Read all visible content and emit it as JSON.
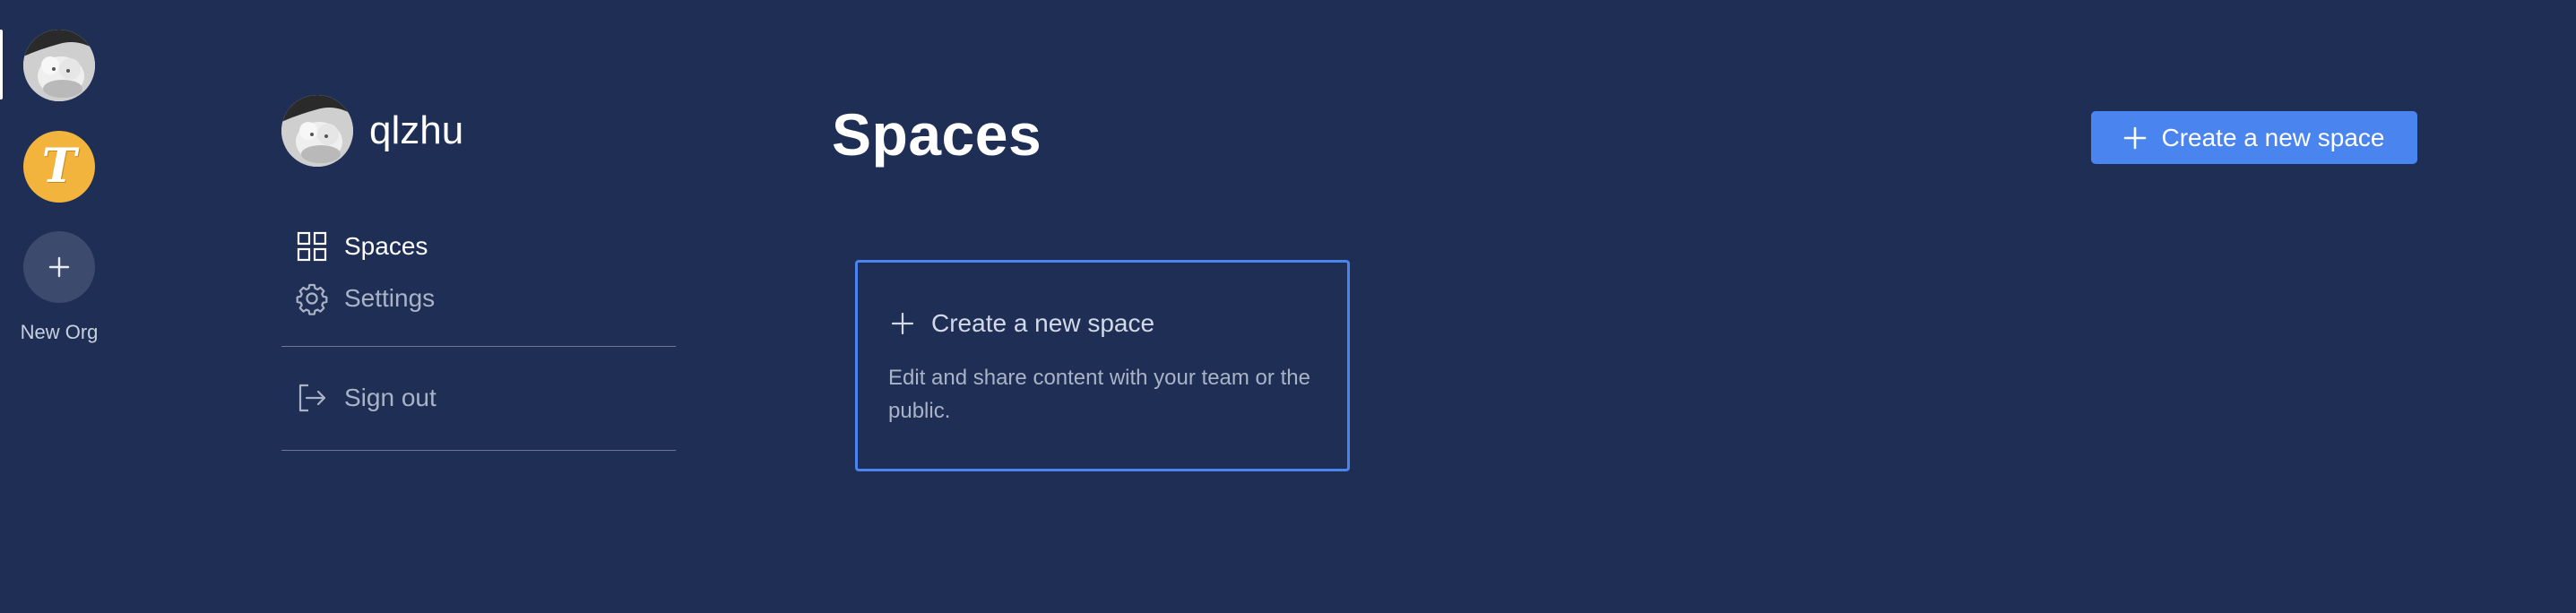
{
  "orgs": {
    "items": [
      {
        "name": "qlzhu",
        "icon": "user-avatar"
      },
      {
        "letter": "T",
        "icon": "org-logo-t"
      }
    ],
    "new_org_label": "New Org"
  },
  "profile": {
    "username": "qlzhu"
  },
  "nav": {
    "items": [
      {
        "label": "Spaces",
        "icon": "grid-icon",
        "active": true
      },
      {
        "label": "Settings",
        "icon": "gear-icon",
        "active": false
      }
    ],
    "signout_label": "Sign out"
  },
  "main": {
    "title": "Spaces",
    "create_button_label": "Create a new space",
    "card": {
      "title": "Create a new space",
      "description": "Edit and share content with your team or the public."
    }
  },
  "colors": {
    "background": "#1e2e55",
    "accent": "#4a84ef",
    "org_yellow": "#f2b43c",
    "muted_text": "#aab3c6"
  }
}
